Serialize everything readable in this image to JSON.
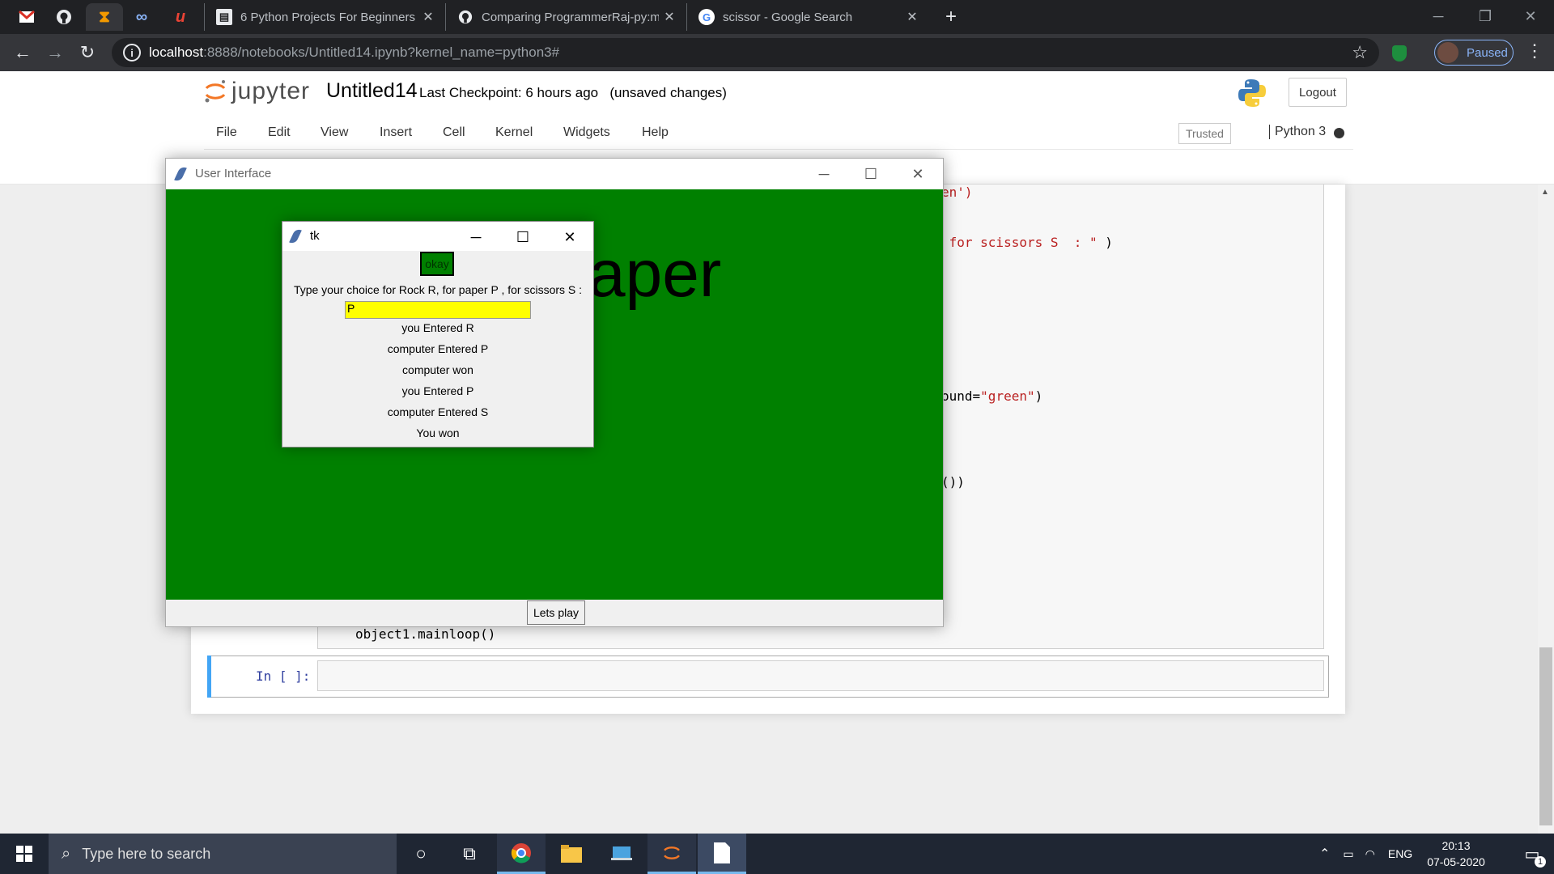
{
  "browser": {
    "tabs": [
      {
        "title": "6 Python Projects For Beginners"
      },
      {
        "title": "Comparing ProgrammerRaj-py:m"
      },
      {
        "title": "scissor - Google Search"
      }
    ],
    "url_host": "localhost",
    "url_path": ":8888/notebooks/Untitled14.ipynb?kernel_name=python3#",
    "profile_label": "Paused"
  },
  "jupyter": {
    "logo_text": "jupyter",
    "notebook_name": "Untitled14",
    "checkpoint": "Last Checkpoint: 6 hours ago",
    "unsaved": "(unsaved changes)",
    "logout_label": "Logout",
    "menu": [
      "File",
      "Edit",
      "View",
      "Insert",
      "Cell",
      "Kernel",
      "Widgets",
      "Help"
    ],
    "trusted_label": "Trusted",
    "kernel_name": "Python 3",
    "code_fragments": {
      "line1_a": "en",
      "line1_b": "')",
      "line2_a": " for scissors S  : \"",
      "line2_b": " )",
      "line3_a": "ound=",
      "line3_b": "\"green\"",
      "line3_c": ")",
      "line4": "())",
      "mainloop": "object1.mainloop()"
    },
    "empty_cell_prompt": "In [ ]:"
  },
  "ui_window": {
    "title": "User Interface",
    "big_text": "aper",
    "lets_play_label": "Lets play",
    "background_color": "#008000"
  },
  "tk_window": {
    "title": "tk",
    "okay_label": "okay",
    "prompt": "Type your choice for Rock R, for paper P ,  for scissors S  :",
    "entry_value": "P",
    "results": [
      "you Entered R",
      "computer Entered P",
      "computer won",
      "you Entered P",
      "computer Entered S",
      "You won"
    ],
    "entry_color": "#ffff00"
  },
  "taskbar": {
    "search_placeholder": "Type here to search",
    "language": "ENG",
    "time": "20:13",
    "date": "07-05-2020",
    "notification_count": "1"
  }
}
